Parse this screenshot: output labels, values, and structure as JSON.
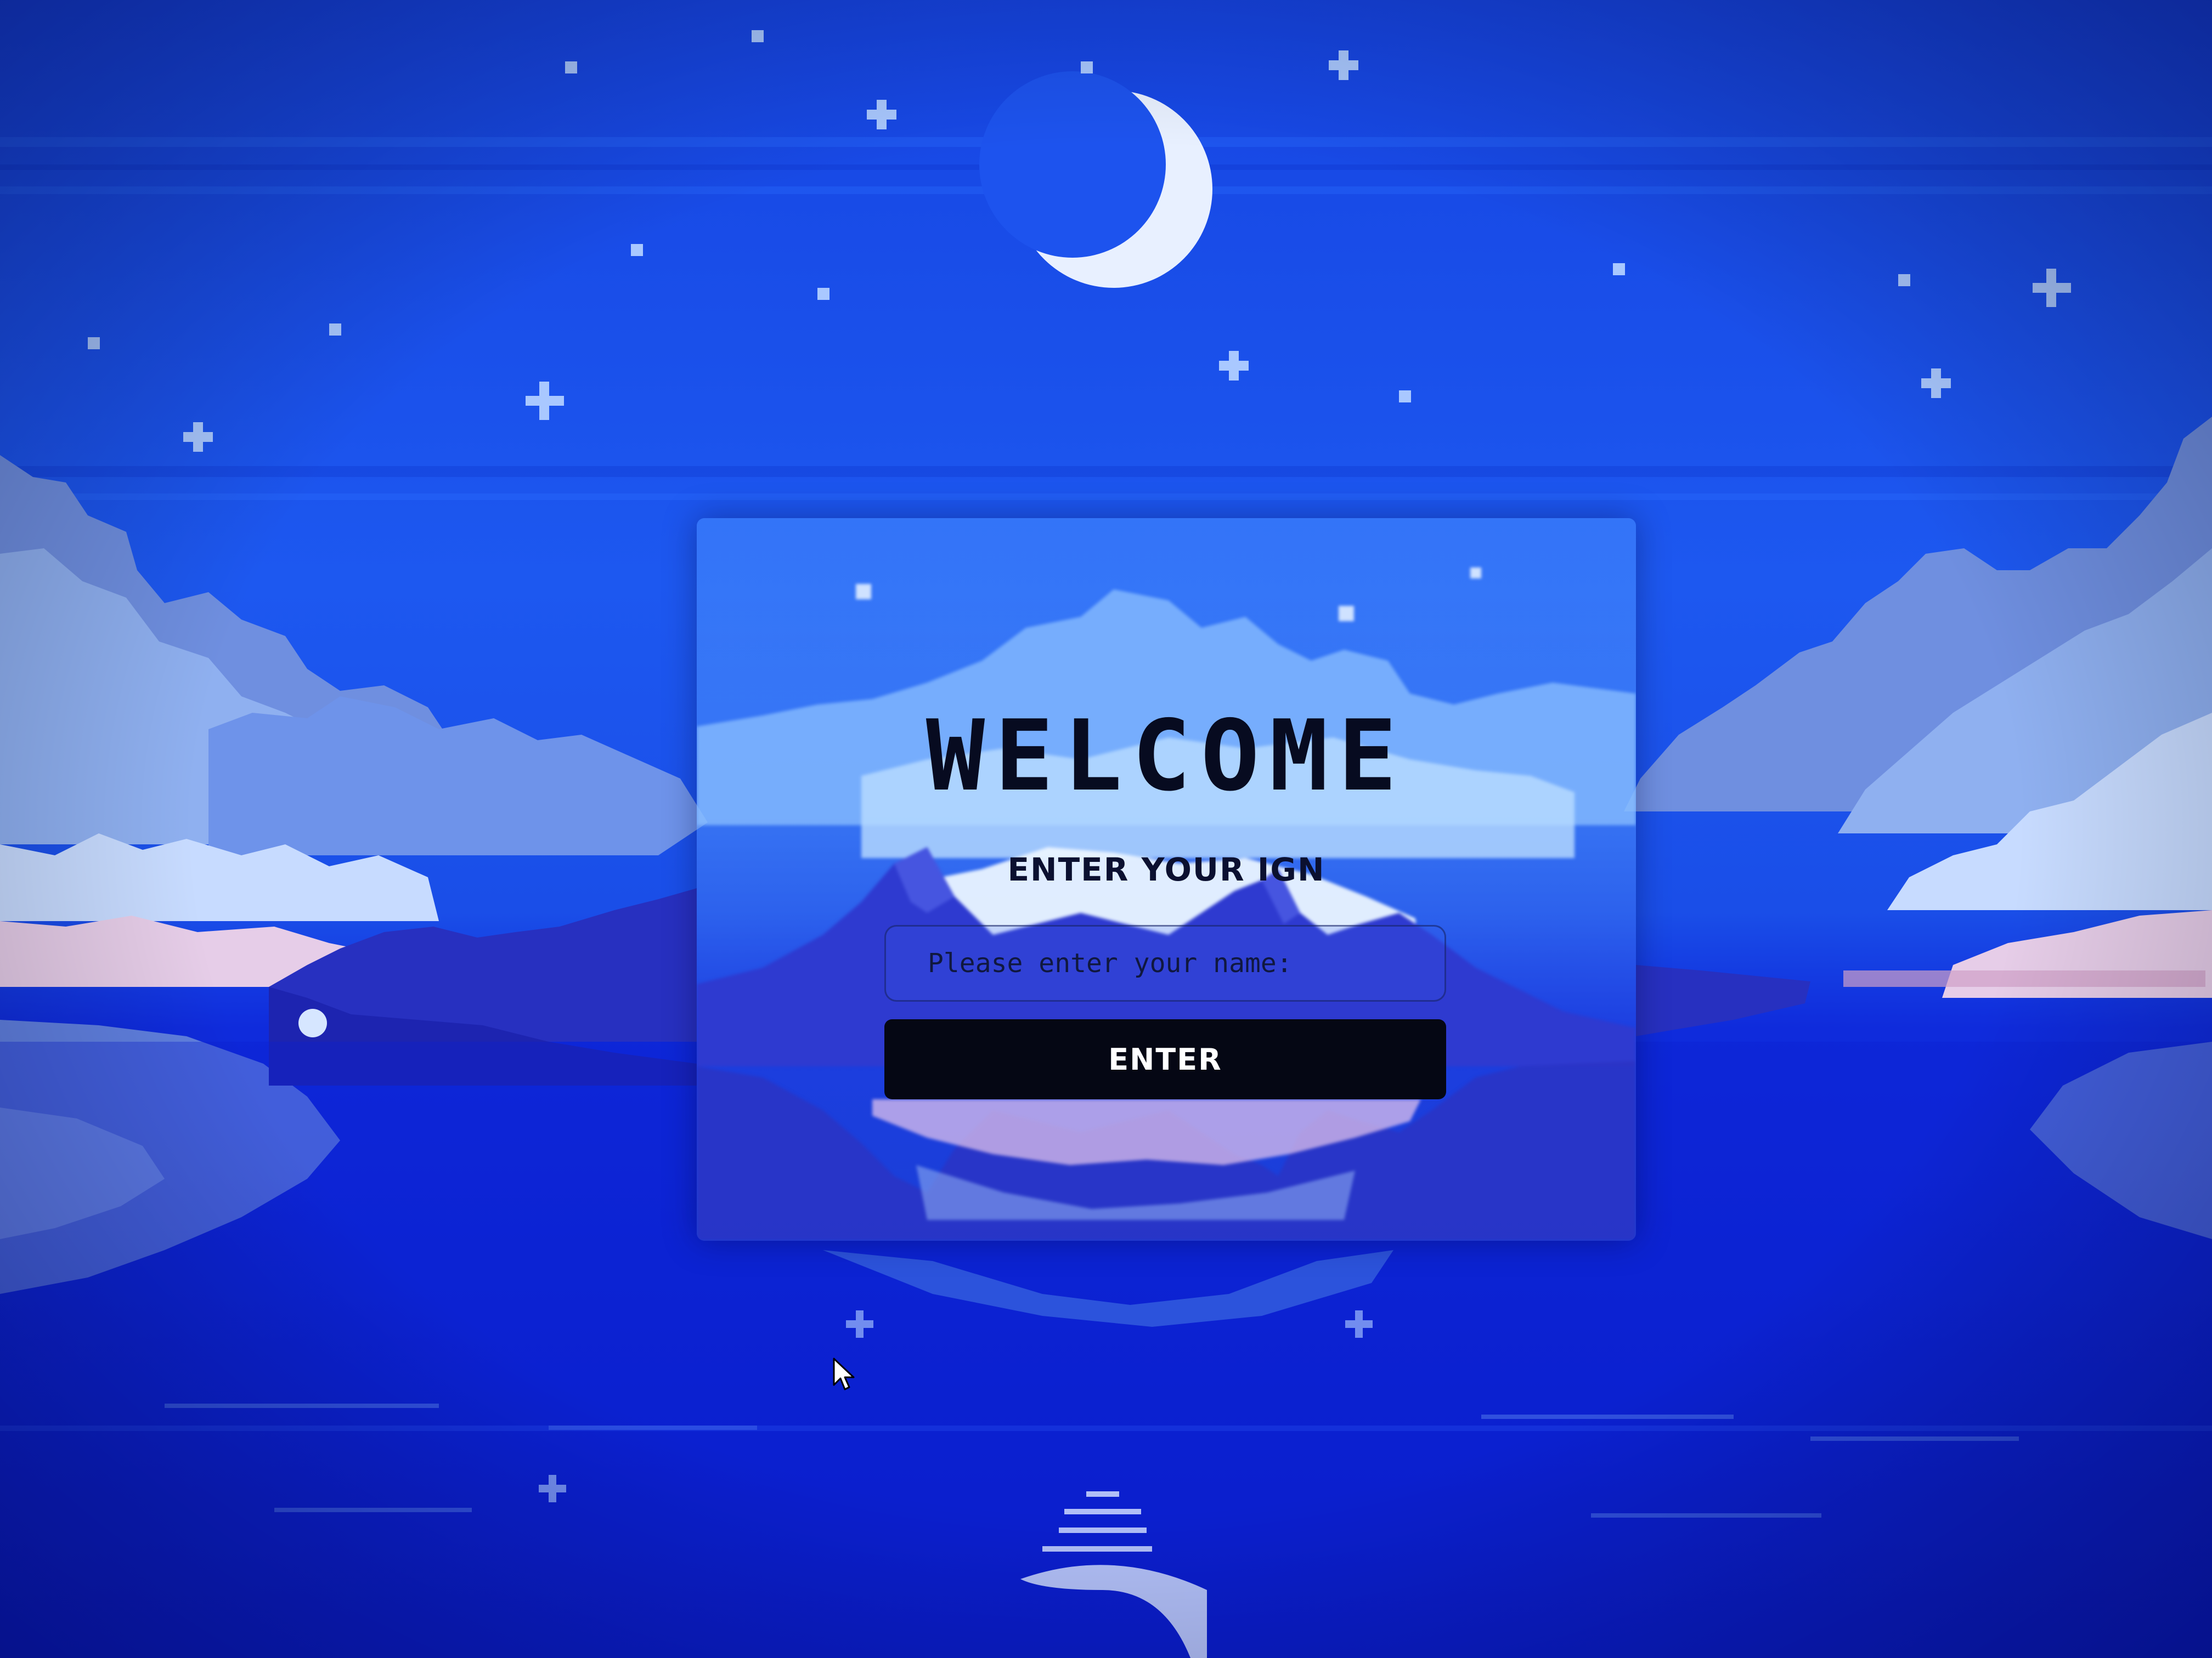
{
  "login": {
    "title": "WELCOME",
    "ign_label": "ENTER YOUR IGN",
    "name_placeholder": "Please enter your name:",
    "name_value": "",
    "enter_label": "ENTER"
  },
  "icons": {
    "moon": "crescent-moon-icon",
    "stars": "sparkle-star-icon",
    "cursor": "mouse-pointer-icon"
  },
  "colors": {
    "sky_top": "#1848e8",
    "sky_mid": "#1f5cf2",
    "water": "#0a1fd8",
    "cloud_light": "#cfe3ff",
    "cloud_mid": "#7fa8f0",
    "cloud_pink": "#e9c7e6",
    "mountain": "#2a33c8",
    "button_bg": "#050714",
    "title_text": "#070b20"
  }
}
